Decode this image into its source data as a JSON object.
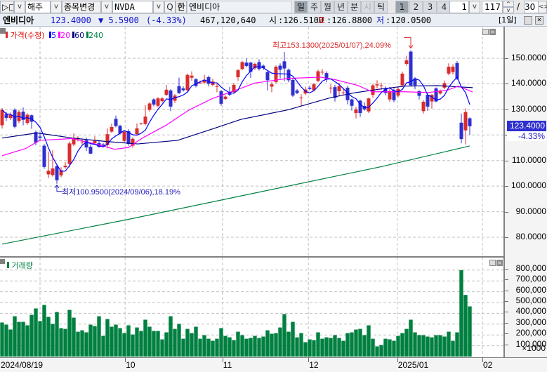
{
  "toolbar": {
    "icon_left": "▷□",
    "market": "해주",
    "change_symbol": "종목변경",
    "symbol": "NVDA",
    "search": "Q",
    "hangul": "한",
    "name": "엔비디아",
    "periods": [
      "일",
      "주",
      "월",
      "년",
      "분",
      "시",
      "틱"
    ],
    "period_selected": "일",
    "layouts": [
      "1",
      "2",
      "3",
      "4"
    ],
    "layout_selected": "1",
    "interval": "1",
    "count": "117",
    "slash": "/",
    "total": "30",
    "dropdown_glyph": "v",
    "spin_up": "^",
    "spin_down": "v",
    "nav": "<>"
  },
  "info": {
    "name": "엔비디아",
    "price": "123.4000",
    "change": "▼ 5.5900",
    "change_pct": "(-4.33%)",
    "volume": "467,120,640",
    "open_label": "시",
    "open": ":126.5100",
    "high_label": "고",
    "high": ":126.8800",
    "low_label": "저",
    "low": ":120.0500",
    "period": "[1일]"
  },
  "legend": {
    "price": "가격(수정)",
    "ma": [
      {
        "label": "5",
        "color": "#0000ff"
      },
      {
        "label": "20",
        "color": "#ff00ff"
      },
      {
        "label": "60",
        "color": "#000080"
      },
      {
        "label": "240",
        "color": "#008040"
      }
    ]
  },
  "annotations": {
    "high": "최고153.1300(2025/01/07),24.09%",
    "low": "최저100.9500(2024/09/06),18.19%"
  },
  "current": {
    "price": "123.4000",
    "pct": "-4.33%"
  },
  "volume_pane": {
    "title": "거래량",
    "unit": "×1000"
  },
  "colors": {
    "up": "#d92c2c",
    "down": "#2f2fd0",
    "volume": "#008040"
  },
  "chart_data": {
    "type": "candlestick",
    "price_axis": {
      "min": 75,
      "max": 157,
      "ticks": [
        150,
        140,
        130,
        120,
        110,
        100,
        90,
        80
      ],
      "tick_labels": [
        "150.0000",
        "140.0000",
        "130.0000",
        "120.0000",
        "110.0000",
        "100.0000",
        "90.0000",
        "80.0000"
      ]
    },
    "volume_axis": {
      "ticks": [
        800,
        700,
        600,
        500,
        400,
        300,
        200,
        100
      ],
      "tick_labels": [
        "800,000",
        "700,000",
        "600,000",
        "500,000",
        "400,000",
        "300,000",
        "200,000",
        "100,000"
      ]
    },
    "x_ticks": [
      {
        "index": -0.5,
        "label": "2024/08/19"
      },
      {
        "index": 9,
        "label": ""
      },
      {
        "index": 29.2,
        "label": "10"
      },
      {
        "index": 52.3,
        "label": "11"
      },
      {
        "index": 72.7,
        "label": "12"
      },
      {
        "index": 93.8,
        "label": "2025/01"
      },
      {
        "index": 114,
        "label": "02"
      }
    ],
    "ohlc": [
      [
        123.8,
        130.5,
        122.5,
        129.8
      ],
      [
        128.1,
        129.0,
        125.5,
        126.7
      ],
      [
        126.6,
        128.8,
        125.8,
        127.9
      ],
      [
        129.8,
        130.4,
        122.6,
        123.2
      ],
      [
        125.4,
        129.8,
        124.6,
        129.0
      ],
      [
        129.1,
        130.7,
        123.8,
        125.9
      ],
      [
        124.7,
        128.5,
        124.0,
        127.9
      ],
      [
        127.7,
        128.0,
        122.4,
        125.2
      ],
      [
        121.1,
        121.8,
        116.0,
        117.0
      ],
      [
        119.4,
        121.0,
        118.0,
        118.9
      ],
      [
        115.8,
        116.4,
        106.8,
        107.5
      ],
      [
        104.6,
        113.5,
        103.2,
        106.0
      ],
      [
        104.3,
        114.0,
        103.7,
        106.9
      ],
      [
        107.8,
        108.2,
        100.95,
        102.3
      ],
      [
        104.2,
        107.4,
        103.5,
        106.2
      ],
      [
        107.4,
        109.4,
        106.8,
        108.0
      ],
      [
        108.7,
        117.4,
        107.3,
        116.7
      ],
      [
        116.3,
        120.6,
        115.6,
        118.8
      ],
      [
        118.3,
        119.5,
        117.5,
        118.8
      ],
      [
        117.4,
        118.6,
        116.2,
        117.4
      ],
      [
        117.9,
        119.0,
        113.7,
        115.1
      ],
      [
        115.4,
        116.2,
        112.5,
        112.7
      ],
      [
        116.8,
        119.5,
        116.2,
        117.7
      ],
      [
        116.8,
        118.0,
        115.0,
        115.4
      ],
      [
        116.3,
        116.8,
        115.2,
        115.8
      ],
      [
        116.0,
        122.6,
        114.8,
        120.3
      ],
      [
        121.3,
        124.5,
        120.8,
        123.1
      ],
      [
        126.3,
        127.6,
        123.0,
        123.5
      ],
      [
        123.6,
        124.0,
        120.2,
        120.6
      ],
      [
        117.7,
        121.8,
        117.2,
        121.3
      ],
      [
        121.5,
        122.2,
        115.8,
        116.5
      ],
      [
        115.8,
        119.0,
        115.0,
        118.5
      ],
      [
        120.3,
        124.5,
        119.8,
        122.6
      ],
      [
        124.5,
        124.8,
        124.0,
        124.5
      ],
      [
        124.3,
        131.6,
        123.8,
        127.2
      ],
      [
        129.8,
        132.8,
        129.2,
        132.3
      ],
      [
        133.9,
        134.4,
        131.2,
        131.9
      ],
      [
        131.4,
        134.8,
        130.8,
        134.3
      ],
      [
        133.2,
        134.8,
        132.6,
        134.3
      ],
      [
        135.7,
        139.6,
        135.2,
        137.7
      ],
      [
        137.4,
        137.9,
        129.3,
        131.1
      ],
      [
        133.4,
        136.0,
        132.5,
        135.4
      ],
      [
        139.1,
        142.4,
        136.0,
        136.4
      ],
      [
        138.2,
        139.0,
        137.0,
        137.5
      ],
      [
        137.5,
        144.0,
        137.0,
        143.5
      ],
      [
        142.4,
        144.9,
        141.2,
        143.2
      ],
      [
        141.8,
        142.2,
        138.6,
        139.2
      ],
      [
        140.5,
        141.3,
        139.8,
        140.5
      ],
      [
        140.5,
        143.6,
        140.0,
        141.4
      ],
      [
        142.6,
        143.2,
        139.0,
        140.0
      ],
      [
        139.6,
        142.0,
        139.0,
        140.9
      ],
      [
        139.1,
        140.0,
        136.7,
        139.1
      ],
      [
        137.1,
        137.6,
        131.4,
        132.2
      ],
      [
        134.1,
        135.5,
        133.6,
        135.0
      ],
      [
        136.8,
        138.8,
        135.2,
        135.7
      ],
      [
        136.8,
        140.4,
        136.2,
        139.6
      ],
      [
        142.6,
        145.8,
        141.2,
        145.3
      ],
      [
        145.8,
        149.0,
        145.3,
        148.5
      ],
      [
        148.3,
        150.0,
        146.4,
        147.0
      ],
      [
        148.3,
        148.6,
        142.3,
        144.7
      ],
      [
        146.1,
        148.2,
        145.4,
        147.8
      ],
      [
        148.5,
        149.6,
        145.2,
        145.8
      ],
      [
        147.1,
        147.6,
        145.4,
        146.2
      ],
      [
        144.6,
        144.9,
        137.4,
        141.4
      ],
      [
        138.9,
        140.6,
        136.7,
        139.8
      ],
      [
        140.7,
        147.2,
        140.2,
        146.7
      ],
      [
        147.1,
        148.0,
        142.1,
        145.5
      ],
      [
        148.8,
        152.5,
        141.0,
        146.0
      ],
      [
        145.5,
        146.0,
        140.6,
        141.4
      ],
      [
        141.5,
        142.0,
        134.9,
        135.4
      ],
      [
        137.4,
        138.0,
        136.0,
        136.4
      ],
      [
        134.6,
        135.9,
        131.4,
        134.6
      ],
      [
        136.2,
        138.9,
        135.6,
        137.8
      ],
      [
        138.5,
        139.3,
        137.5,
        138.0
      ],
      [
        137.5,
        140.4,
        137.0,
        139.8
      ],
      [
        141.2,
        145.5,
        140.6,
        144.9
      ],
      [
        144.7,
        145.8,
        143.6,
        144.7
      ],
      [
        144.2,
        144.9,
        140.6,
        141.8
      ],
      [
        138.5,
        139.8,
        136.2,
        138.5
      ],
      [
        138.7,
        139.6,
        133.1,
        134.5
      ],
      [
        137.1,
        140.4,
        135.2,
        139.1
      ],
      [
        136.6,
        138.2,
        135.8,
        136.6
      ],
      [
        138.5,
        139.3,
        132.0,
        133.6
      ],
      [
        133.9,
        134.2,
        129.5,
        131.4
      ],
      [
        128.6,
        131.0,
        126.5,
        130.0
      ],
      [
        133.4,
        133.8,
        127.0,
        128.6
      ],
      [
        131.3,
        132.8,
        129.5,
        130.0
      ],
      [
        129.2,
        134.6,
        128.6,
        134.3
      ],
      [
        135.7,
        140.0,
        134.5,
        139.4
      ],
      [
        139.4,
        141.4,
        138.2,
        139.8
      ],
      [
        139.1,
        140.5,
        137.6,
        139.4
      ],
      [
        138.2,
        139.0,
        135.5,
        136.4
      ],
      [
        133.9,
        138.8,
        133.0,
        137.1
      ],
      [
        137.5,
        138.3,
        132.8,
        133.6
      ],
      [
        135.4,
        138.8,
        134.8,
        138.0
      ],
      [
        139.4,
        144.8,
        139.0,
        144.0
      ],
      [
        147.8,
        151.0,
        147.0,
        149.2
      ],
      [
        152.6,
        153.13,
        139.0,
        139.4
      ],
      [
        142.1,
        142.6,
        137.9,
        139.4
      ],
      [
        137.1,
        137.5,
        133.9,
        135.3
      ],
      [
        129.3,
        133.6,
        128.4,
        133.0
      ],
      [
        135.7,
        136.2,
        129.4,
        131.1
      ],
      [
        133.1,
        136.0,
        130.3,
        135.7
      ],
      [
        138.2,
        138.6,
        132.8,
        133.1
      ],
      [
        136.2,
        137.8,
        135.8,
        137.3
      ],
      [
        138.5,
        141.3,
        137.9,
        140.3
      ],
      [
        144.0,
        148.0,
        143.3,
        146.7
      ],
      [
        144.6,
        147.6,
        143.7,
        146.7
      ],
      [
        148.1,
        148.9,
        141.5,
        142.1
      ],
      [
        124.8,
        128.4,
        116.7,
        118.4
      ],
      [
        121.8,
        130.4,
        116.3,
        128.99
      ],
      [
        126.51,
        126.88,
        120.05,
        123.4
      ]
    ],
    "volume_k": [
      315,
      295,
      250,
      373,
      321,
      321,
      289,
      386,
      445,
      328,
      477,
      367,
      302,
      412,
      263,
      256,
      432,
      360,
      230,
      243,
      224,
      295,
      282,
      373,
      191,
      347,
      276,
      295,
      263,
      217,
      289,
      204,
      269,
      237,
      341,
      276,
      237,
      237,
      159,
      224,
      373,
      256,
      302,
      165,
      256,
      217,
      276,
      165,
      198,
      165,
      146,
      165,
      263,
      191,
      178,
      152,
      230,
      198,
      165,
      172,
      191,
      172,
      185,
      243,
      211,
      217,
      269,
      393,
      230,
      321,
      178,
      217,
      133,
      159,
      152,
      224,
      165,
      178,
      172,
      198,
      172,
      146,
      217,
      224,
      250,
      256,
      198,
      289,
      165,
      94,
      107,
      165,
      159,
      146,
      191,
      217,
      256,
      341,
      224,
      198,
      198,
      185,
      178,
      198,
      198,
      185,
      230,
      146,
      224,
      800,
      570,
      464
    ],
    "ma20": [
      [
        0,
        111.9
      ],
      [
        5.6,
        114.7
      ],
      [
        8.9,
        117.9
      ],
      [
        16.7,
        118.6
      ],
      [
        23.3,
        116.0
      ],
      [
        26.7,
        114.4
      ],
      [
        30,
        115.1
      ],
      [
        33.3,
        118.8
      ],
      [
        38.9,
        123.8
      ],
      [
        44.4,
        129.8
      ],
      [
        50,
        134.3
      ],
      [
        55.6,
        137.6
      ],
      [
        60,
        140.3
      ],
      [
        67.8,
        142.1
      ],
      [
        75.6,
        142.6
      ],
      [
        78.9,
        141.7
      ],
      [
        84.4,
        139.4
      ],
      [
        87.8,
        136.9
      ],
      [
        95.6,
        136.9
      ],
      [
        101.1,
        136.6
      ],
      [
        105.6,
        137.5
      ],
      [
        108.3,
        139.1
      ],
      [
        111.7,
        136.8
      ]
    ],
    "ma60": [
      [
        0,
        118.8
      ],
      [
        8.3,
        120.8
      ],
      [
        16.7,
        118.8
      ],
      [
        25,
        117.4
      ],
      [
        32.2,
        116.5
      ],
      [
        41.7,
        117.9
      ],
      [
        50,
        122.4
      ],
      [
        56.7,
        126.1
      ],
      [
        67.8,
        129.8
      ],
      [
        77.8,
        134.5
      ],
      [
        83.3,
        136.4
      ],
      [
        90,
        138.0
      ],
      [
        95.6,
        139.1
      ],
      [
        103.3,
        139.3
      ],
      [
        111.7,
        138.5
      ]
    ],
    "ma240": [
      [
        0,
        77.3
      ],
      [
        30,
        87.0
      ],
      [
        60,
        97.3
      ],
      [
        90,
        107.6
      ],
      [
        111,
        115.7
      ]
    ]
  }
}
